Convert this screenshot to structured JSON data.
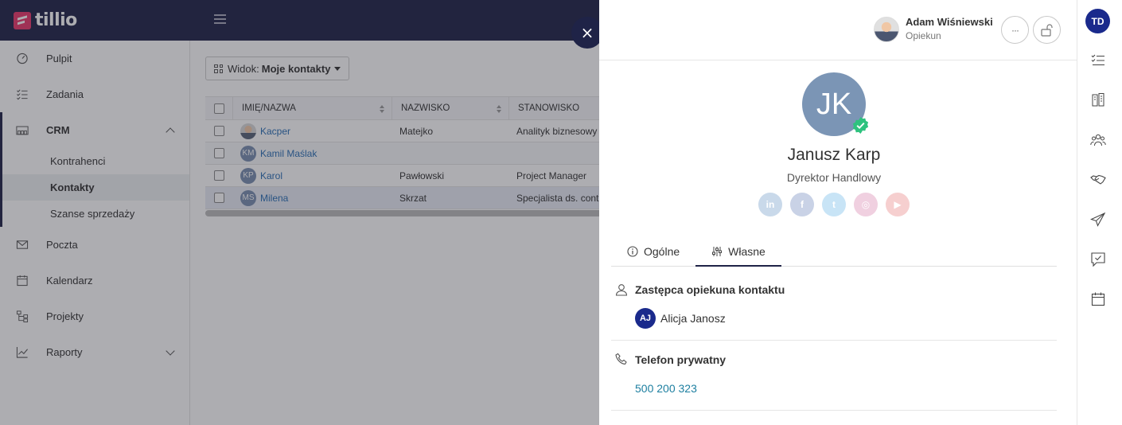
{
  "brand": {
    "name": "tillio",
    "accent": "#e8386b",
    "navy": "#1f2347"
  },
  "sidebar": {
    "items": [
      {
        "label": "Pulpit",
        "icon": "gauge-icon"
      },
      {
        "label": "Zadania",
        "icon": "checklist-icon"
      },
      {
        "label": "CRM",
        "icon": "building-group-icon"
      },
      {
        "label": "Poczta",
        "icon": "envelope-icon"
      },
      {
        "label": "Kalendarz",
        "icon": "calendar-icon"
      },
      {
        "label": "Projekty",
        "icon": "sitemap-icon"
      },
      {
        "label": "Raporty",
        "icon": "chart-icon"
      }
    ],
    "crm_sub": [
      "Kontrahenci",
      "Kontakty",
      "Szanse sprzedaży"
    ],
    "active_sub": "Kontakty"
  },
  "main": {
    "view_label": "Widok:",
    "view_value": "Moje kontakty",
    "columns": [
      "IMIĘ/NAZWA",
      "NAZWISKO",
      "STANOWISKO"
    ],
    "rows": [
      {
        "initials": "",
        "first": "Kacper",
        "last": "Matejko",
        "position": "Analityk biznesowy"
      },
      {
        "initials": "KM",
        "first": "Kamil Maślak",
        "last": "",
        "position": ""
      },
      {
        "initials": "KP",
        "first": "Karol",
        "last": "Pawłowski",
        "position": "Project Manager"
      },
      {
        "initials": "MS",
        "first": "Milena",
        "last": "Skrzat",
        "position": "Specjalista ds. cont"
      }
    ]
  },
  "panel": {
    "close_symbol": "×",
    "owner": {
      "name": "Adam Wiśniewski",
      "role": "Opiekun"
    },
    "more_symbol": "···",
    "contact": {
      "initials": "JK",
      "name": "Janusz Karp",
      "title": "Dyrektor Handlowy"
    },
    "socials": [
      {
        "name": "linkedin",
        "glyph": "in",
        "color": "#c9d9ea"
      },
      {
        "name": "facebook",
        "glyph": "f",
        "color": "#c9d2e6"
      },
      {
        "name": "twitter",
        "glyph": "t",
        "color": "#c8e4f6"
      },
      {
        "name": "instagram",
        "glyph": "◎",
        "color": "#f0d0e0"
      },
      {
        "name": "youtube",
        "glyph": "▶",
        "color": "#f6cfcf"
      }
    ],
    "tabs": [
      "Ogólne",
      "Własne"
    ],
    "active_tab": "Własne",
    "sections": {
      "deputy": {
        "title": "Zastępca opiekuna kontaktu",
        "person_initials": "AJ",
        "person_name": "Alicja Janosz"
      },
      "phone": {
        "title": "Telefon prywatny",
        "value": "500 200 323"
      }
    }
  },
  "rail": {
    "user_initials": "TD"
  }
}
